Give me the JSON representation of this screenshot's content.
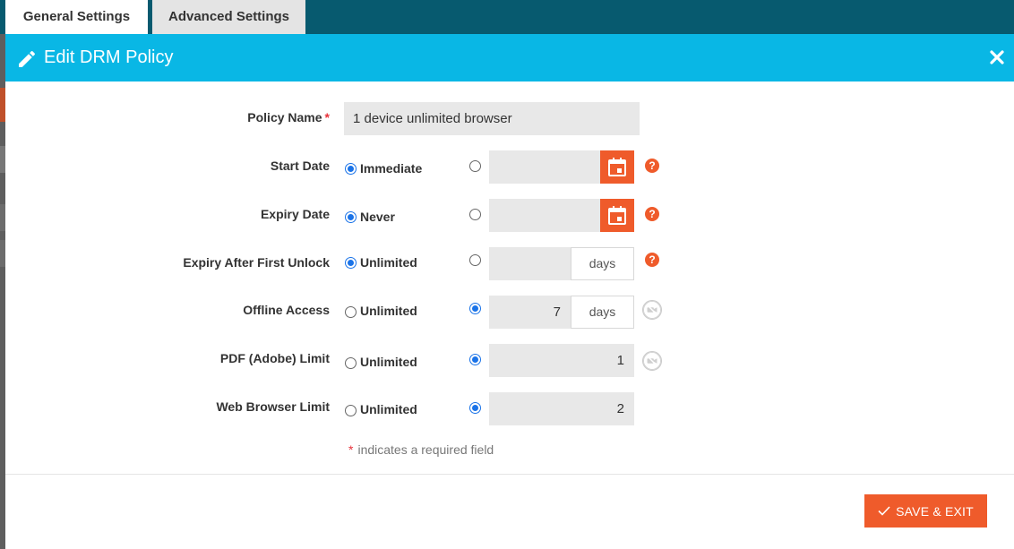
{
  "tabs": [
    {
      "label": "General Settings",
      "active": true
    },
    {
      "label": "Advanced Settings",
      "active": false
    }
  ],
  "modal": {
    "title": "Edit DRM Policy",
    "icon": "pencil-icon",
    "close_icon": "close-icon"
  },
  "form": {
    "policy_name": {
      "label": "Policy Name",
      "required_mark": "*",
      "value": "1 device unlimited browser"
    },
    "start_date": {
      "label": "Start Date",
      "option_label": "Immediate",
      "selected": "Immediate",
      "value": ""
    },
    "expiry_date": {
      "label": "Expiry Date",
      "option_label": "Never",
      "selected": "Never",
      "value": ""
    },
    "expiry_after_first_unlock": {
      "label": "Expiry After First Unlock",
      "option_label": "Unlimited",
      "selected": "Unlimited",
      "value": "",
      "unit": "days"
    },
    "offline_access": {
      "label": "Offline Access",
      "option_label": "Unlimited",
      "selected": "custom",
      "value": "7",
      "unit": "days"
    },
    "pdf_limit": {
      "label": "PDF (Adobe) Limit",
      "option_label": "Unlimited",
      "selected": "custom",
      "value": "1"
    },
    "web_browser_limit": {
      "label": "Web Browser Limit",
      "option_label": "Unlimited",
      "selected": "custom",
      "value": "2"
    }
  },
  "required_note": {
    "star": "*",
    "text": "indicates a required field"
  },
  "footer": {
    "save_label": "SAVE & EXIT"
  },
  "colors": {
    "header": "#09b7e5",
    "topbar": "#075a6f",
    "accent": "#ef5b2b",
    "radio": "#1a73e8"
  }
}
